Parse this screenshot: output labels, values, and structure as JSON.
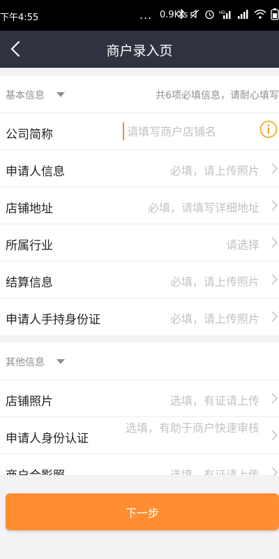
{
  "status_bar": {
    "time": "下午4:55",
    "dots": "...",
    "speed": "0.9K/s",
    "icons": [
      "bluetooth-icon",
      "mute-icon",
      "alarm-icon",
      "hd-signal-icon",
      "signal-icon",
      "wifi-icon",
      "battery-icon"
    ]
  },
  "header": {
    "title": "商户录入页",
    "back_icon": "chevron-left-icon"
  },
  "basic_section": {
    "label": "基本信息",
    "hint": "共6项必填信息，请耐心填写",
    "rows": [
      {
        "label": "公司简称",
        "placeholder": "请填写商户店铺名",
        "value": ""
      },
      {
        "label": "申请人信息",
        "value": "必填，请上传照片"
      },
      {
        "label": "店铺地址",
        "value": "必填，请填写详细地址"
      },
      {
        "label": "所属行业",
        "value": "请选择"
      },
      {
        "label": "结算信息",
        "value": "必填，请上传照片"
      },
      {
        "label": "申请人手持身份证",
        "value": "必填，请上传照片"
      }
    ]
  },
  "other_section": {
    "label": "其他信息",
    "rows": [
      {
        "label": "店铺照片",
        "value": "选填，有证请上传"
      },
      {
        "label": "申请人身份认证",
        "value": "选填，有助于商户快速审核"
      },
      {
        "label": "商户合影照",
        "value": "选填，有证请上传"
      }
    ]
  },
  "next_button": {
    "label": "下一步"
  },
  "colors": {
    "status_bg": "#000000",
    "header_bg": "#2f3340",
    "accent": "#ff8e33",
    "info_icon": "#f5a623",
    "placeholder": "#c2c2c6"
  }
}
